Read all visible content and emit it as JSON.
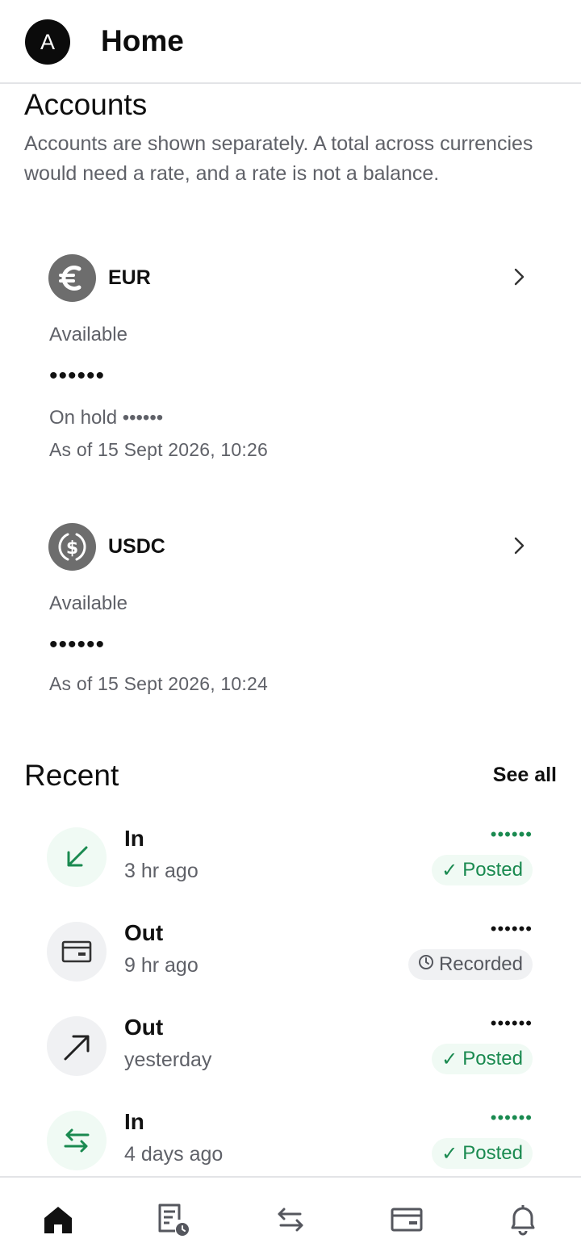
{
  "header": {
    "avatar_initial": "A",
    "title": "Home"
  },
  "accounts": {
    "title": "Accounts",
    "note": "Accounts are shown separately. A total across currencies would need a rate, and a rate is not a balance.",
    "items": [
      {
        "code": "EUR",
        "icon": "euro-icon",
        "available_label": "Available",
        "available_value": "••••••",
        "on_hold": "On hold ••••••",
        "as_of": "As of 15 Sept 2026, 10:26"
      },
      {
        "code": "USDC",
        "icon": "dollar-circle-icon",
        "available_label": "Available",
        "available_value": "••••••",
        "as_of": "As of 15 Sept 2026, 10:24"
      }
    ]
  },
  "recent": {
    "title": "Recent",
    "see_all": "See all",
    "items": [
      {
        "title": "In",
        "time": "3 hr ago",
        "amount": "••••••",
        "status": "Posted",
        "icon": "arrow-down-left-icon"
      },
      {
        "title": "Out",
        "time": "9 hr ago",
        "amount": "••••••",
        "status": "Recorded",
        "icon": "card-icon"
      },
      {
        "title": "Out",
        "time": "yesterday",
        "amount": "••••••",
        "status": "Posted",
        "icon": "arrow-up-right-icon"
      },
      {
        "title": "In",
        "time": "4 days ago",
        "amount": "••••••",
        "status": "Posted",
        "icon": "transfer-icon"
      }
    ]
  },
  "nav": {
    "items": [
      {
        "name": "home",
        "icon": "home-icon",
        "active": true
      },
      {
        "name": "statements",
        "icon": "statement-clock-icon",
        "active": false
      },
      {
        "name": "transfers",
        "icon": "transfer-arrows-icon",
        "active": false
      },
      {
        "name": "cards",
        "icon": "card-icon",
        "active": false
      },
      {
        "name": "notifications",
        "icon": "bell-icon",
        "active": false
      }
    ]
  },
  "colors": {
    "green": "#1a8a50",
    "grey_text": "#5f6168",
    "icon_grey": "#6d6d6d",
    "nav_icon": "#55575e"
  }
}
